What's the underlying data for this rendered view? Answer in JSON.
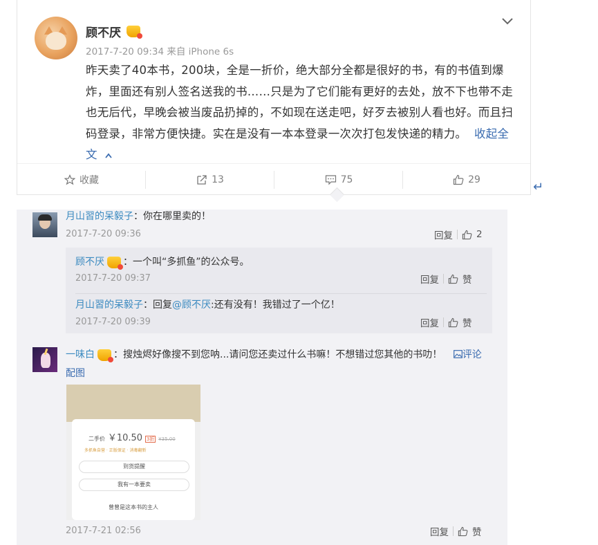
{
  "post": {
    "author": "顾不厌",
    "meta": "2017-7-20 09:34 来自 iPhone 6s",
    "text": "昨天卖了40本书，200块，全是一折价，绝大部分全都是很好的书，有的书值到爆炸，里面还有别人签名送我的书……只是为了它们能有更好的去处，放不下也带不走也无后代，早晚会被当废品扔掉的，不如现在送走吧，好歹去被别人看也好。而且扫码登录，非常方便快捷。实在是没有一本本登录一次次打包发快递的精力。",
    "collapse_label": "收起全文",
    "actions": {
      "favorite": "收藏",
      "repost_count": "13",
      "comment_count": "75",
      "like_count": "29"
    }
  },
  "comments": [
    {
      "user": "月山習的呆毅子",
      "text": "：你在哪里卖的！",
      "date": "2017-7-20 09:36",
      "reply": "回复",
      "likes": "2",
      "subreplies": [
        {
          "user": "顾不厌",
          "text": "：一个叫“多抓鱼”的公众号。",
          "date": "2017-7-20 09:37",
          "reply": "回复",
          "likes": "赞"
        },
        {
          "user": "月山習的呆毅子",
          "prefix": "：回复",
          "mention": "@顾不厌",
          "text": ":还有没有！我错过了一个亿！",
          "date": "2017-7-20 09:39",
          "reply": "回复",
          "likes": "赞"
        }
      ]
    },
    {
      "user": "一味白",
      "text": "：搜烛烬好像搜不到您呐...请问您还卖过什么书嘛！不想错过您其他的书叻！",
      "comment_link": "评论配图",
      "date": "2017-7-21 02:56",
      "reply": "回复",
      "likes": "赞",
      "image": {
        "price_label": "二手价",
        "price": "￥10.50",
        "discount": "3折",
        "orig_price": "¥35.00",
        "tags": "多抓鱼自营 · 正版保证 · 消毒翻新",
        "btn1": "到货提醒",
        "btn2": "我有一本要卖",
        "owner": "曾曾是这本书的主人"
      }
    }
  ],
  "colors": {
    "link": "#3b6cb0",
    "username": "#3b8ac0",
    "panel_bg": "#f2f2f5"
  },
  "icons": [
    "chevron-down-icon",
    "star-icon",
    "share-icon",
    "comment-icon",
    "thumb-up-icon",
    "image-icon",
    "return-arrow-icon"
  ]
}
